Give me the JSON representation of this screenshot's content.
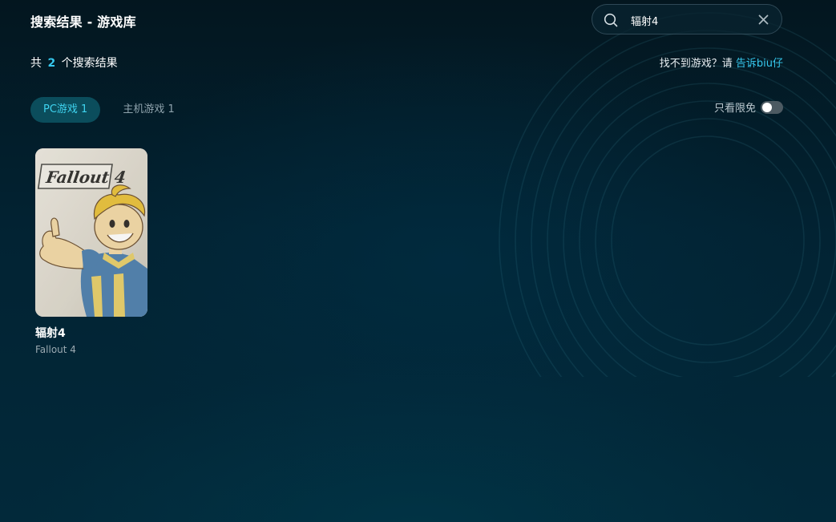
{
  "header": {
    "title": "搜索结果 - 游戏库"
  },
  "search": {
    "value": "辐射4"
  },
  "results": {
    "prefix": "共",
    "count": "2",
    "suffix": "个搜索结果"
  },
  "help": {
    "text": "找不到游戏？请",
    "link": "告诉biu仔"
  },
  "tabs": [
    {
      "label": "PC游戏 1",
      "active": true
    },
    {
      "label": "主机游戏 1",
      "active": false
    }
  ],
  "filter": {
    "free_only_label": "只看限免",
    "free_only_enabled": false
  },
  "games": [
    {
      "title": "辐射4",
      "subtitle": "Fallout 4",
      "cover_logo": "Fallout 4"
    }
  ],
  "colors": {
    "accent": "#36c8ee",
    "tab_active_bg": "#0b4d5c"
  }
}
